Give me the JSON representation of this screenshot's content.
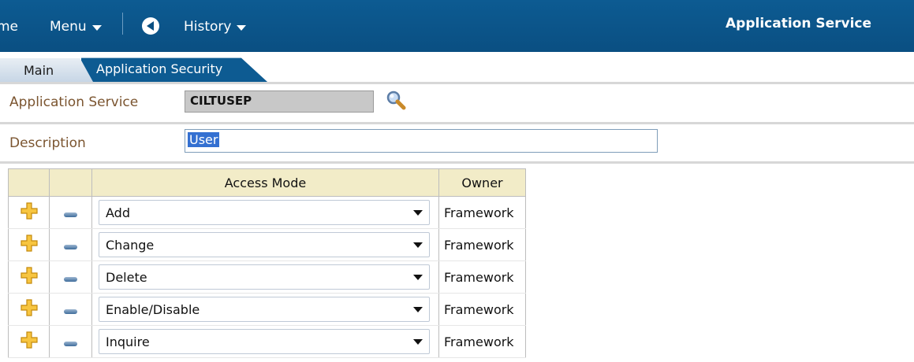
{
  "header": {
    "home_label": "me",
    "menu_label": "Menu",
    "history_label": "History",
    "title": "Application Service",
    "back_icon": "circle-back-arrow-icon"
  },
  "tabs": [
    {
      "label": "Main",
      "active": true
    },
    {
      "label": "Application Security",
      "active": false
    }
  ],
  "form": {
    "app_service_label": "Application Service",
    "app_service_value": "CILTUSEP",
    "description_label": "Description",
    "description_value": "User",
    "search_icon": "magnifier-icon"
  },
  "grid": {
    "columns": [
      "",
      "",
      "Access Mode",
      "Owner"
    ],
    "rows": [
      {
        "mode": "Add",
        "owner": "Framework"
      },
      {
        "mode": "Change",
        "owner": "Framework"
      },
      {
        "mode": "Delete",
        "owner": "Framework"
      },
      {
        "mode": "Enable/Disable",
        "owner": "Framework"
      },
      {
        "mode": "Inquire",
        "owner": "Framework"
      }
    ],
    "add_icon": "add-row-plus-icon",
    "remove_icon": "remove-row-minus-icon"
  },
  "colors": {
    "header_bg": "#0a4f82",
    "label_text": "#7b5530",
    "grid_header_bg": "#f2ecc8",
    "add_icon": "#f0b622",
    "selection": "#3470d1"
  }
}
